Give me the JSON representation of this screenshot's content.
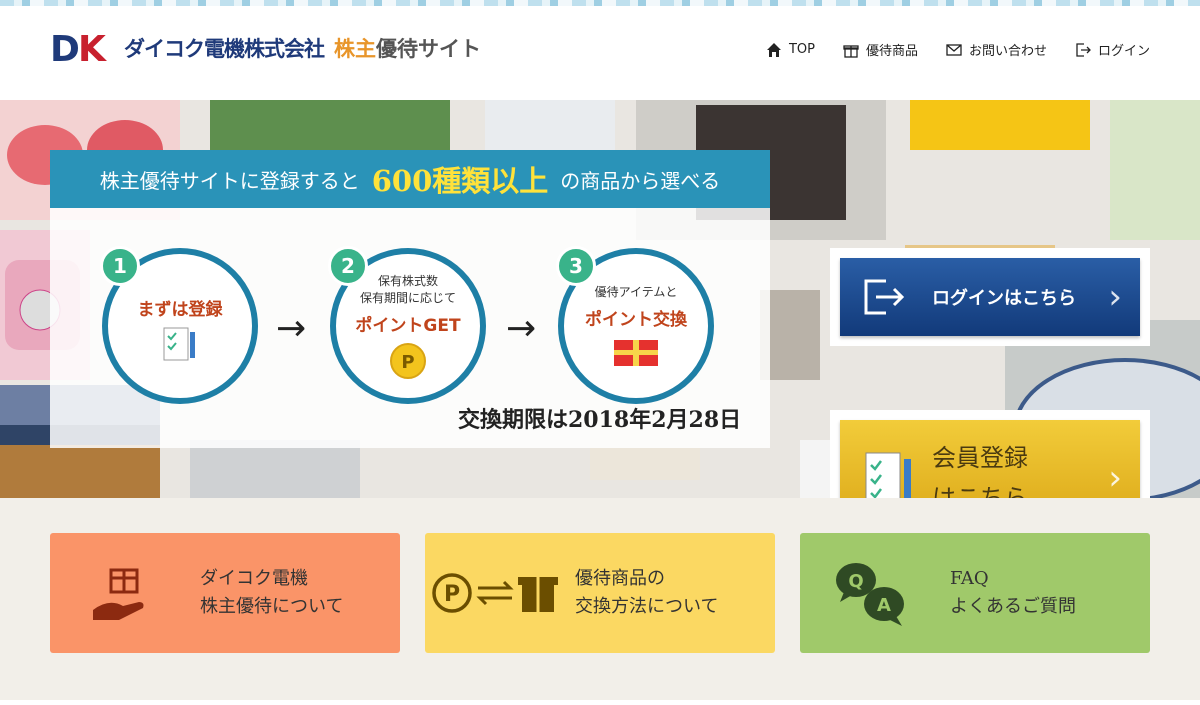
{
  "header": {
    "logo_mark": "DK",
    "logo_company": "ダイコク電機株式会社",
    "logo_site_a": "株主",
    "logo_site_b": "優待サイト",
    "nav": [
      {
        "label": "TOP",
        "icon": "home-icon"
      },
      {
        "label": "優待商品",
        "icon": "gift-icon"
      },
      {
        "label": "お問い合わせ",
        "icon": "mail-icon"
      },
      {
        "label": "ログイン",
        "icon": "login-icon"
      }
    ]
  },
  "hero": {
    "banner_pre": "株主優待サイトに登録すると",
    "banner_highlight": "600種類以上",
    "banner_post": "の商品から選べる",
    "steps": [
      {
        "num": "1",
        "sub": "",
        "main": "まずは登録"
      },
      {
        "num": "2",
        "sub": "保有株式数\n保有期間に応じて",
        "main": "ポイントGET"
      },
      {
        "num": "3",
        "sub": "優待アイテムと",
        "main": "ポイント交換"
      }
    ],
    "deadline": "交換期限は2018年2月28日",
    "login_button": "ログインはこちら",
    "register_button_line1": "会員登録",
    "register_button_line2": "はこちら"
  },
  "cards": [
    {
      "line1": "ダイコク電機",
      "line2": "株主優待について",
      "color": "#fa9468"
    },
    {
      "line1": "優待商品の",
      "line2": "交換方法について",
      "color": "#fbd862"
    },
    {
      "line1": "FAQ",
      "line2": "よくあるご質問",
      "color": "#a0c96a"
    }
  ],
  "colors": {
    "brand_blue": "#1f3a7a",
    "accent_orange": "#e8952a",
    "banner_teal": "#2a93b8",
    "step_border": "#1e7fa6",
    "step_num": "#39b38a"
  }
}
